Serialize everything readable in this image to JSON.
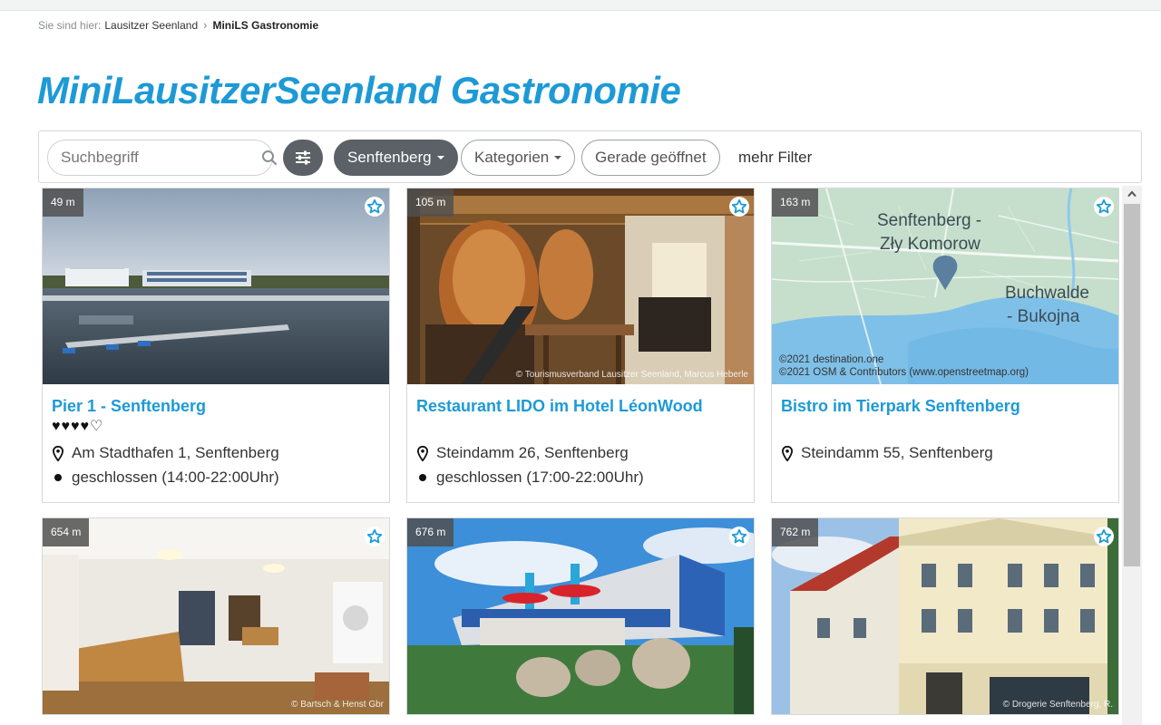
{
  "breadcrumb": {
    "prefix": "Sie sind hier:",
    "items": [
      "Lausitzer Seenland",
      "MiniLS Gastronomie"
    ]
  },
  "page_title": "MiniLausitzerSeenland Gastronomie",
  "filters": {
    "search_placeholder": "Suchbegriff",
    "location": "Senftenberg",
    "categories": "Kategorien",
    "open_now": "Gerade geöffnet",
    "more": "mehr Filter"
  },
  "colors": {
    "accent": "#1d9ad6",
    "dark_pill": "#5b6166"
  },
  "cards": [
    {
      "distance": "49 m",
      "title": "Pier 1 - Senftenberg",
      "rating": "♥♥♥♥♡",
      "address": "Am Stadthafen 1, Senftenberg",
      "status": "geschlossen (14:00-22:00Uhr)",
      "credit": "",
      "image": "harbor-photo"
    },
    {
      "distance": "105 m",
      "title": "Restaurant LIDO im Hotel LéonWood",
      "rating": "",
      "address": "Steindamm 26, Senftenberg",
      "status": "geschlossen (17:00-22:00Uhr)",
      "credit": "© Tourismusverband Lausitzer Seenland, Marcus Heberle",
      "image": "brewery-restaurant-photo"
    },
    {
      "distance": "163 m",
      "title": "Bistro im Tierpark Senftenberg",
      "rating": "",
      "address": "Steindamm 55, Senftenberg",
      "status": "",
      "credit": "",
      "image": "map",
      "map": {
        "label_1": "Senftenberg -",
        "label_2": "Zły Komorow",
        "label_3": "Buchwalde",
        "label_4": "- Bukojna",
        "attribution_1": "©2021 destination.one",
        "attribution_2": "©2021 OSM & Contributors (www.openstreetmap.org)"
      }
    },
    {
      "distance": "654 m",
      "title": "",
      "rating": "",
      "address": "",
      "status": "",
      "credit": "© Bartsch & Henst Gbr",
      "image": "cafe-interior-photo"
    },
    {
      "distance": "676 m",
      "title": "",
      "rating": "",
      "address": "",
      "status": "",
      "credit": "",
      "image": "modern-building-photo"
    },
    {
      "distance": "762 m",
      "title": "",
      "rating": "",
      "address": "",
      "status": "",
      "credit": "© Drogerie Senftenberg, R.",
      "image": "historic-building-photo"
    }
  ]
}
